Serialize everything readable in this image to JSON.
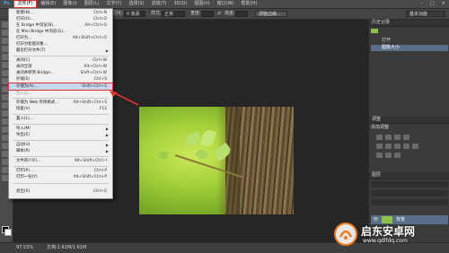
{
  "menubar": {
    "items": [
      "文件(F)",
      "编辑(E)",
      "图像(I)",
      "图层(L)",
      "文字(Y)",
      "选择(S)",
      "滤镜(T)",
      "3D(D)",
      "视图(V)",
      "窗口(W)",
      "帮助(H)"
    ]
  },
  "options": {
    "feather_label": "羽化:",
    "feather_value": "0 像素",
    "style_label": "样式:",
    "style_value": "正常",
    "width_label": "宽度:",
    "height_label": "高度:",
    "refine_button": "调整边缘...",
    "workspace": "基本功能"
  },
  "file_menu": {
    "items": [
      {
        "label": "新建(N)...",
        "shortcut": "Ctrl+N"
      },
      {
        "label": "打开(O)...",
        "shortcut": "Ctrl+O"
      },
      {
        "label": "在 Bridge 中浏览(B)...",
        "shortcut": "Alt+Ctrl+O"
      },
      {
        "label": "在 Mini Bridge 中浏览(G)...",
        "shortcut": ""
      },
      {
        "label": "打开为...",
        "shortcut": "Alt+Shift+Ctrl+O"
      },
      {
        "label": "打开为智能对象...",
        "shortcut": ""
      },
      {
        "label": "最近打开文件(T)",
        "shortcut": ""
      },
      {
        "label": "关闭(C)",
        "shortcut": "Ctrl+W"
      },
      {
        "label": "关闭全部",
        "shortcut": "Alt+Ctrl+W"
      },
      {
        "label": "关闭并转到 Bridge...",
        "shortcut": "Shift+Ctrl+W"
      },
      {
        "label": "存储(S)",
        "shortcut": "Ctrl+S"
      },
      {
        "label": "存储为(A)...",
        "shortcut": "Shift+Ctrl+S"
      },
      {
        "label": "签入(I)...",
        "shortcut": ""
      },
      {
        "label": "存储为 Web 所用格式...",
        "shortcut": "Alt+Shift+Ctrl+S"
      },
      {
        "label": "恢复(V)",
        "shortcut": "F12"
      },
      {
        "label": "置入(L)...",
        "shortcut": ""
      },
      {
        "label": "导入(M)",
        "shortcut": ""
      },
      {
        "label": "导出(E)",
        "shortcut": ""
      },
      {
        "label": "自动(U)",
        "shortcut": ""
      },
      {
        "label": "脚本(R)",
        "shortcut": ""
      },
      {
        "label": "文件简介(F)...",
        "shortcut": "Alt+Shift+Ctrl+I"
      },
      {
        "label": "打印(P)...",
        "shortcut": "Ctrl+P"
      },
      {
        "label": "打印一份(Y)",
        "shortcut": "Alt+Shift+Ctrl+P"
      },
      {
        "label": "退出(X)",
        "shortcut": "Ctrl+Q"
      }
    ]
  },
  "panels": {
    "history_tab": "历史记录",
    "history_items": [
      "打开",
      "图像大小"
    ],
    "adjust_tab": "调整",
    "adjust_title": "添加调整",
    "layers_tab": "图层",
    "layer_name": "背景"
  },
  "status": {
    "zoom": "97.53%",
    "doc": "文档:1.61M/1.61M"
  },
  "watermark": {
    "title": "启东安卓网",
    "url": "www.qdlfdq.com"
  },
  "colors": {
    "highlight_outline": "#e0322e",
    "menu_bg": "#f0f0f0",
    "selection_blue": "#5a6e8a"
  }
}
